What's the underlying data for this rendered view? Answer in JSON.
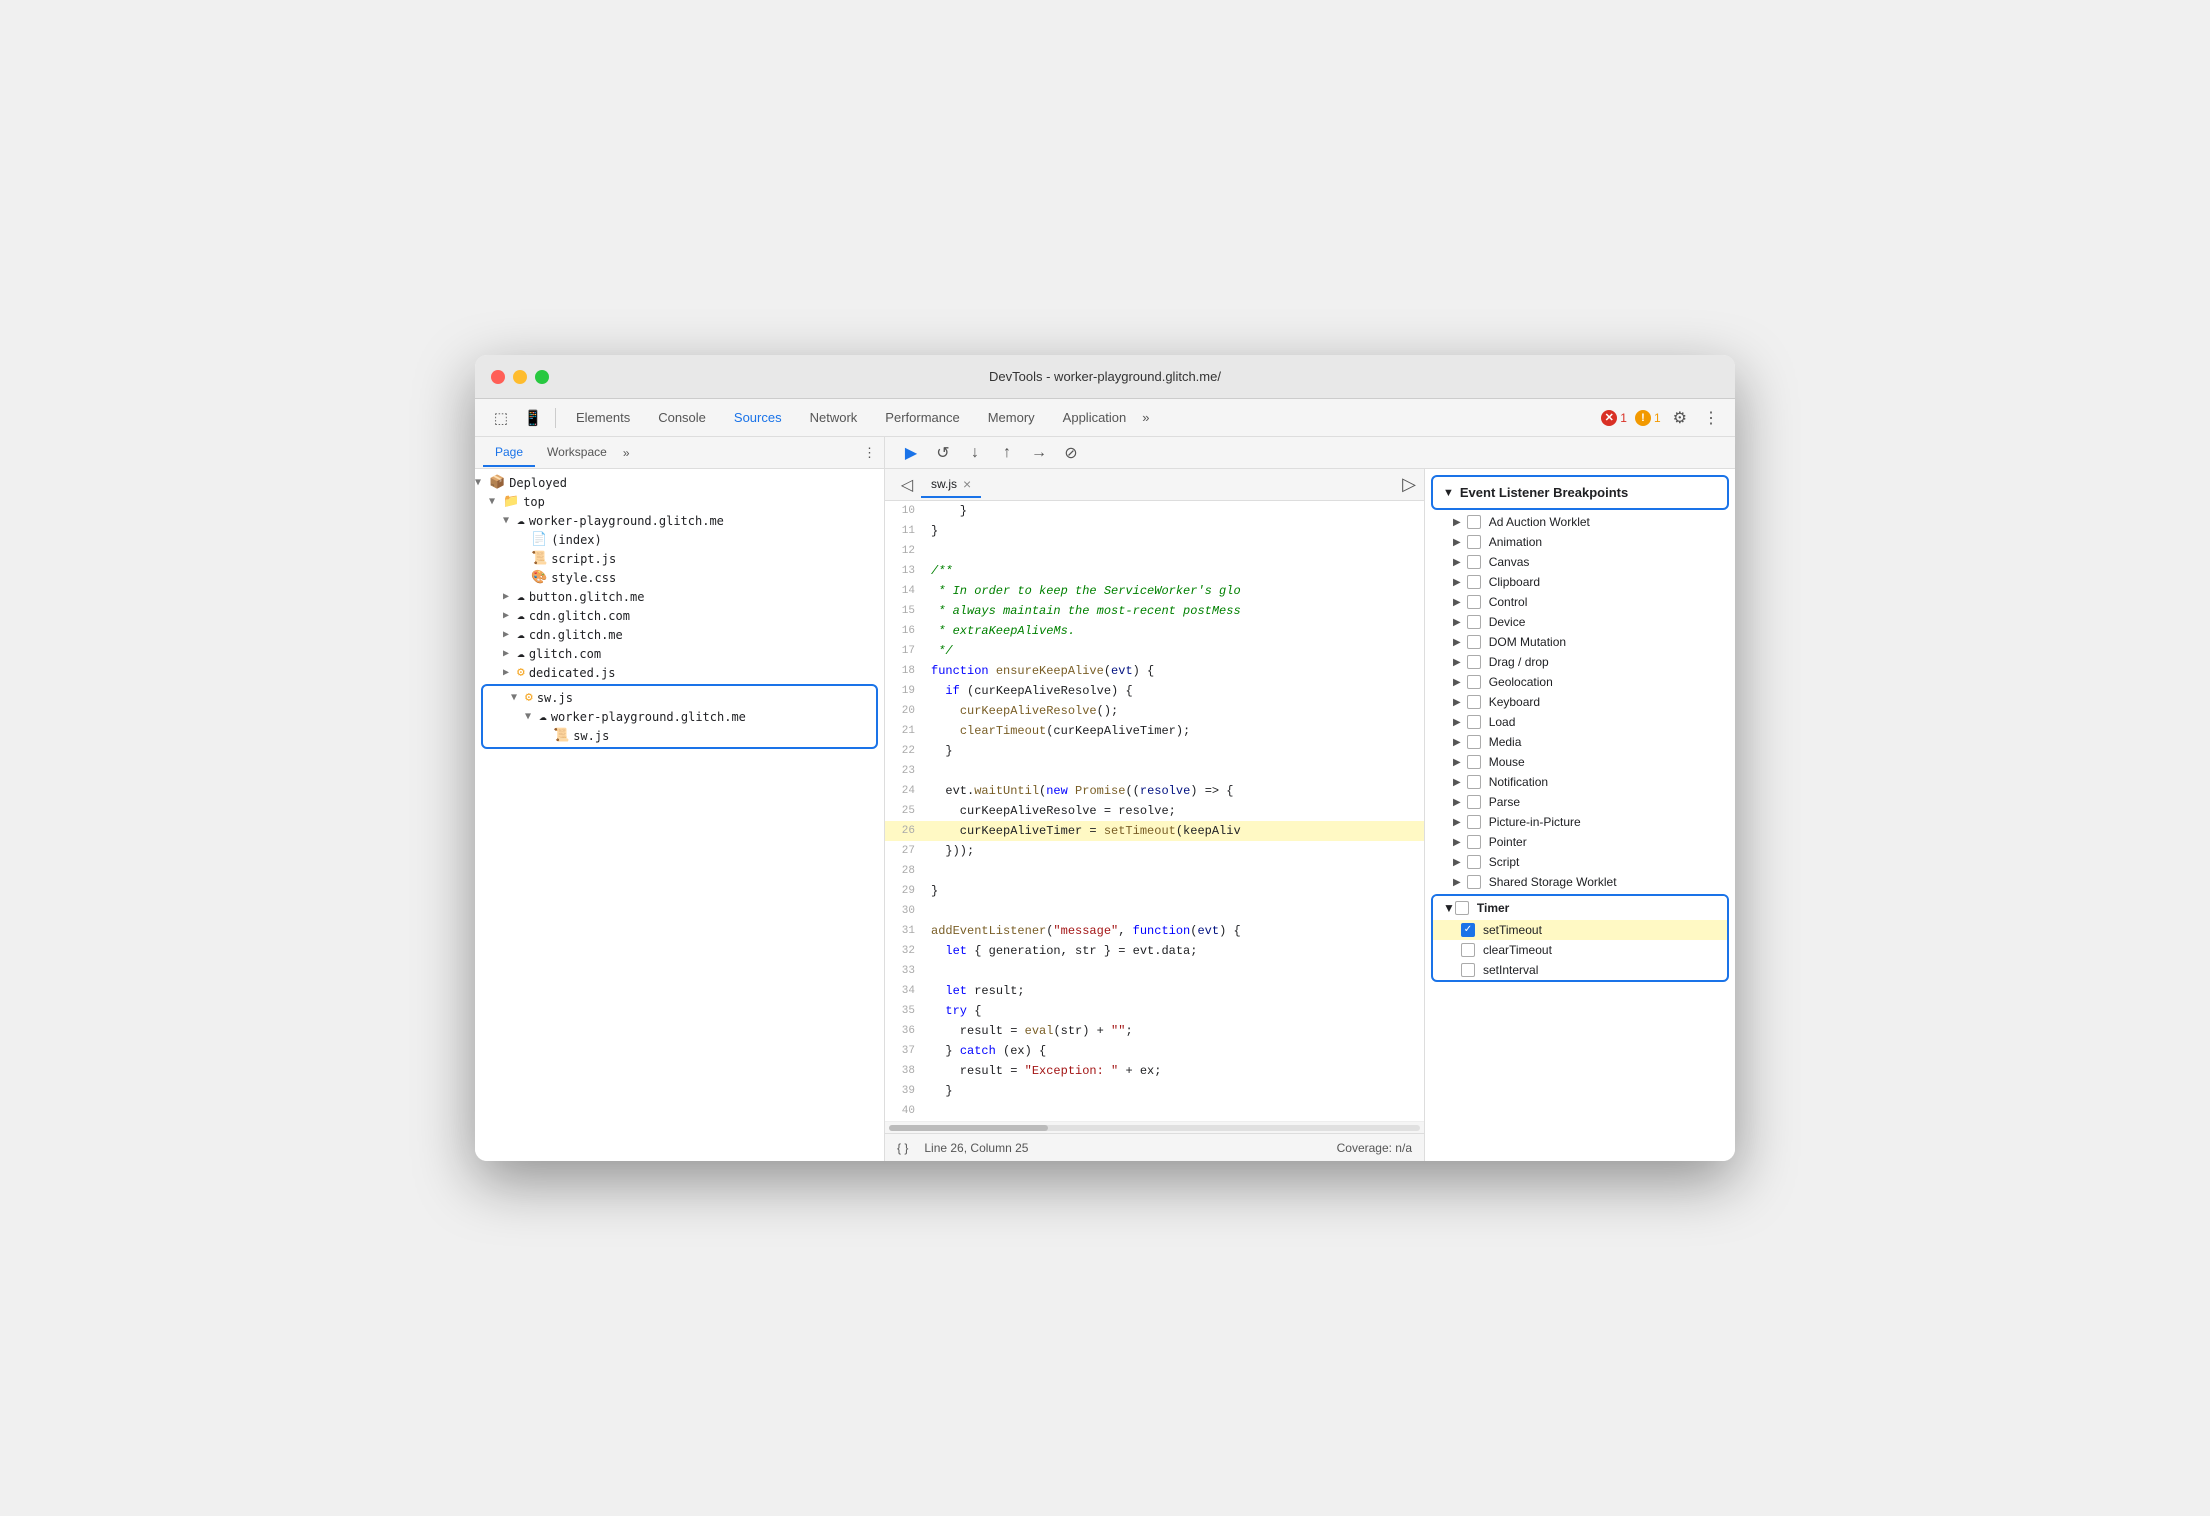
{
  "window": {
    "title": "DevTools - worker-playground.glitch.me/"
  },
  "toolbar": {
    "tabs": [
      {
        "label": "Elements",
        "active": false
      },
      {
        "label": "Console",
        "active": false
      },
      {
        "label": "Sources",
        "active": true
      },
      {
        "label": "Network",
        "active": false
      },
      {
        "label": "Performance",
        "active": false
      },
      {
        "label": "Memory",
        "active": false
      },
      {
        "label": "Application",
        "active": false
      }
    ],
    "more_label": "»",
    "error_count": "1",
    "warning_count": "1"
  },
  "left_panel": {
    "tabs": [
      "Page",
      "Workspace"
    ],
    "more": "»",
    "file_tree": [
      {
        "indent": 0,
        "arrow": "▼",
        "icon": "📦",
        "label": "Deployed"
      },
      {
        "indent": 1,
        "arrow": "▼",
        "icon": "📁",
        "label": "top"
      },
      {
        "indent": 2,
        "arrow": "▼",
        "icon": "☁",
        "label": "worker-playground.glitch.me"
      },
      {
        "indent": 3,
        "arrow": "",
        "icon": "📄",
        "label": "(index)"
      },
      {
        "indent": 3,
        "arrow": "",
        "icon": "📜",
        "label": "script.js",
        "type": "js"
      },
      {
        "indent": 3,
        "arrow": "",
        "icon": "🎨",
        "label": "style.css",
        "type": "css"
      },
      {
        "indent": 2,
        "arrow": "▶",
        "icon": "☁",
        "label": "button.glitch.me"
      },
      {
        "indent": 2,
        "arrow": "▶",
        "icon": "☁",
        "label": "cdn.glitch.com"
      },
      {
        "indent": 2,
        "arrow": "▶",
        "icon": "☁",
        "label": "cdn.glitch.me"
      },
      {
        "indent": 2,
        "arrow": "▶",
        "icon": "☁",
        "label": "glitch.com"
      },
      {
        "indent": 2,
        "arrow": "▶",
        "icon": "⚙",
        "label": "dedicated.js",
        "type": "js"
      },
      {
        "indent": 2,
        "arrow": "▼",
        "icon": "⚙",
        "label": "sw.js",
        "type": "sw",
        "selected": true,
        "group_start": true
      },
      {
        "indent": 3,
        "arrow": "▼",
        "icon": "☁",
        "label": "worker-playground.glitch.me",
        "selected": true
      },
      {
        "indent": 4,
        "arrow": "",
        "icon": "📜",
        "label": "sw.js",
        "type": "sw",
        "selected": true,
        "group_end": true
      }
    ]
  },
  "code_editor": {
    "tab_label": "sw.js",
    "lines": [
      {
        "num": 10,
        "content": "    }"
      },
      {
        "num": 11,
        "content": "}"
      },
      {
        "num": 12,
        "content": ""
      },
      {
        "num": 13,
        "content": "/**",
        "type": "comment"
      },
      {
        "num": 14,
        "content": " * In order to keep the ServiceWorker's glo",
        "type": "comment"
      },
      {
        "num": 15,
        "content": " * always maintain the most-recent postMess",
        "type": "comment"
      },
      {
        "num": 16,
        "content": " * extraKeepAliveMs.",
        "type": "comment"
      },
      {
        "num": 17,
        "content": " */",
        "type": "comment"
      },
      {
        "num": 18,
        "content": "function ensureKeepAlive(evt) {",
        "type": "code"
      },
      {
        "num": 19,
        "content": "  if (curKeepAliveResolve) {",
        "type": "code"
      },
      {
        "num": 20,
        "content": "    curKeepAliveResolve();",
        "type": "code"
      },
      {
        "num": 21,
        "content": "    clearTimeout(curKeepAliveTimer);",
        "type": "code"
      },
      {
        "num": 22,
        "content": "  }",
        "type": "code"
      },
      {
        "num": 23,
        "content": "",
        "type": "code"
      },
      {
        "num": 24,
        "content": "  evt.waitUntil(new Promise((resolve) => {",
        "type": "code"
      },
      {
        "num": 25,
        "content": "    curKeepAliveResolve = resolve;",
        "type": "code"
      },
      {
        "num": 26,
        "content": "    curKeepAliveTimer = setTimeout(keepAliv",
        "type": "code",
        "highlighted": true
      },
      {
        "num": 27,
        "content": "  }));",
        "type": "code"
      },
      {
        "num": 28,
        "content": "",
        "type": "code"
      },
      {
        "num": 29,
        "content": "}",
        "type": "code"
      },
      {
        "num": 30,
        "content": "",
        "type": "code"
      },
      {
        "num": 31,
        "content": "addEventListener(\"message\", function(evt) {",
        "type": "code"
      },
      {
        "num": 32,
        "content": "  let { generation, str } = evt.data;",
        "type": "code"
      },
      {
        "num": 33,
        "content": "",
        "type": "code"
      },
      {
        "num": 34,
        "content": "  let result;",
        "type": "code"
      },
      {
        "num": 35,
        "content": "  try {",
        "type": "code"
      },
      {
        "num": 36,
        "content": "    result = eval(str) + \"\";",
        "type": "code"
      },
      {
        "num": 37,
        "content": "  } catch (ex) {",
        "type": "code"
      },
      {
        "num": 38,
        "content": "    result = \"Exception: \" + ex;",
        "type": "code"
      },
      {
        "num": 39,
        "content": "  }",
        "type": "code"
      },
      {
        "num": 40,
        "content": "",
        "type": "code"
      }
    ],
    "status": {
      "format": "{ }",
      "position": "Line 26, Column 25",
      "coverage": "Coverage: n/a"
    }
  },
  "breakpoints": {
    "main_header": "Event Listener Breakpoints",
    "items": [
      {
        "label": "Ad Auction Worklet",
        "checked": false,
        "expandable": true
      },
      {
        "label": "Animation",
        "checked": false,
        "expandable": true
      },
      {
        "label": "Canvas",
        "checked": false,
        "expandable": true
      },
      {
        "label": "Clipboard",
        "checked": false,
        "expandable": true
      },
      {
        "label": "Control",
        "checked": false,
        "expandable": true
      },
      {
        "label": "Device",
        "checked": false,
        "expandable": true
      },
      {
        "label": "DOM Mutation",
        "checked": false,
        "expandable": true
      },
      {
        "label": "Drag / drop",
        "checked": false,
        "expandable": true
      },
      {
        "label": "Geolocation",
        "checked": false,
        "expandable": true
      },
      {
        "label": "Keyboard",
        "checked": false,
        "expandable": true
      },
      {
        "label": "Load",
        "checked": false,
        "expandable": true
      },
      {
        "label": "Media",
        "checked": false,
        "expandable": true
      },
      {
        "label": "Mouse",
        "checked": false,
        "expandable": true
      },
      {
        "label": "Notification",
        "checked": false,
        "expandable": true
      },
      {
        "label": "Parse",
        "checked": false,
        "expandable": true
      },
      {
        "label": "Picture-in-Picture",
        "checked": false,
        "expandable": true
      },
      {
        "label": "Pointer",
        "checked": false,
        "expandable": true
      },
      {
        "label": "Script",
        "checked": false,
        "expandable": true
      },
      {
        "label": "Shared Storage Worklet",
        "checked": false,
        "expandable": true
      }
    ],
    "timer": {
      "label": "Timer",
      "items": [
        {
          "label": "setTimeout",
          "checked": true
        },
        {
          "label": "clearTimeout",
          "checked": false
        },
        {
          "label": "setInterval",
          "checked": false
        }
      ]
    }
  },
  "debug_buttons": [
    "▶",
    "↺",
    "↓",
    "↑",
    "→",
    "⊘"
  ]
}
